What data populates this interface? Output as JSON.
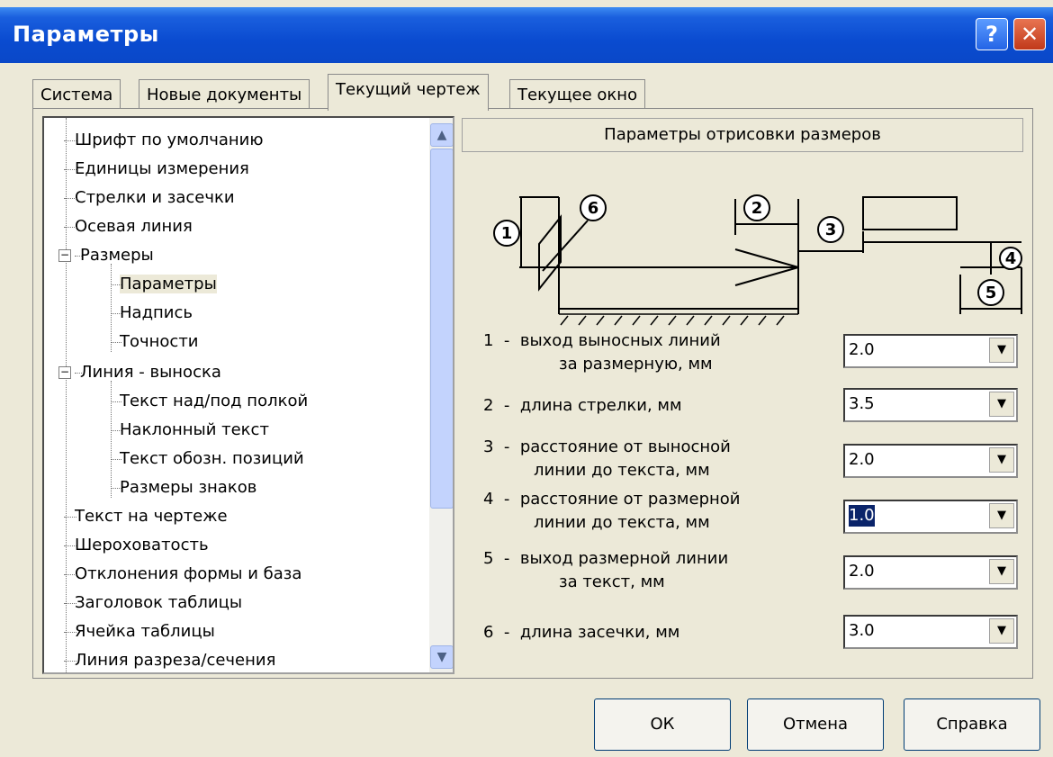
{
  "window": {
    "title": "Параметры",
    "help_label": "?",
    "close_label": "✕"
  },
  "tabs": [
    {
      "label": "Система"
    },
    {
      "label": "Новые документы"
    },
    {
      "label": "Текущий чертеж"
    },
    {
      "label": "Текущее окно"
    }
  ],
  "tree": {
    "items": [
      {
        "label": "Шрифт по умолчанию"
      },
      {
        "label": "Единицы измерения"
      },
      {
        "label": "Стрелки и засечки"
      },
      {
        "label": "Осевая линия"
      },
      {
        "label": "Размеры"
      },
      {
        "label": "Параметры"
      },
      {
        "label": "Надпись"
      },
      {
        "label": "Точности"
      },
      {
        "label": "Линия - выноска"
      },
      {
        "label": "Текст над/под полкой"
      },
      {
        "label": "Наклонный текст"
      },
      {
        "label": "Текст обозн. позиций"
      },
      {
        "label": "Размеры знаков"
      },
      {
        "label": "Текст на чертеже"
      },
      {
        "label": "Шероховатость"
      },
      {
        "label": "Отклонения формы и база"
      },
      {
        "label": "Заголовок таблицы"
      },
      {
        "label": "Ячейка таблицы"
      },
      {
        "label": "Линия разреза/сечения"
      }
    ],
    "expander_minus": "−"
  },
  "panel": {
    "header": "Параметры отрисовки размеров"
  },
  "diagram": {
    "labels": [
      "1",
      "2",
      "3",
      "4",
      "5",
      "6"
    ]
  },
  "params": [
    {
      "line1": "1  -  выход выносных линий",
      "line2": "за размерную, мм",
      "value": "2.0"
    },
    {
      "line1": "2  -  длина стрелки, мм",
      "line2": "",
      "value": "3.5"
    },
    {
      "line1": "3  -  расстояние от выносной",
      "line2": "линии до текста, мм",
      "value": "2.0"
    },
    {
      "line1": "4  -  расстояние от размерной",
      "line2": "линии до текста, мм",
      "value": "1.0"
    },
    {
      "line1": "5  -  выход размерной линии",
      "line2": "за текст, мм",
      "value": "2.0"
    },
    {
      "line1": "6  -  длина засечки, мм",
      "line2": "",
      "value": "3.0"
    }
  ],
  "buttons": {
    "ok": "ОК",
    "cancel": "Отмена",
    "help": "Справка"
  },
  "colors": {
    "titlebar": "#0a4bd0",
    "selection": "#0a246a",
    "dialog_bg": "#ece9d8"
  }
}
